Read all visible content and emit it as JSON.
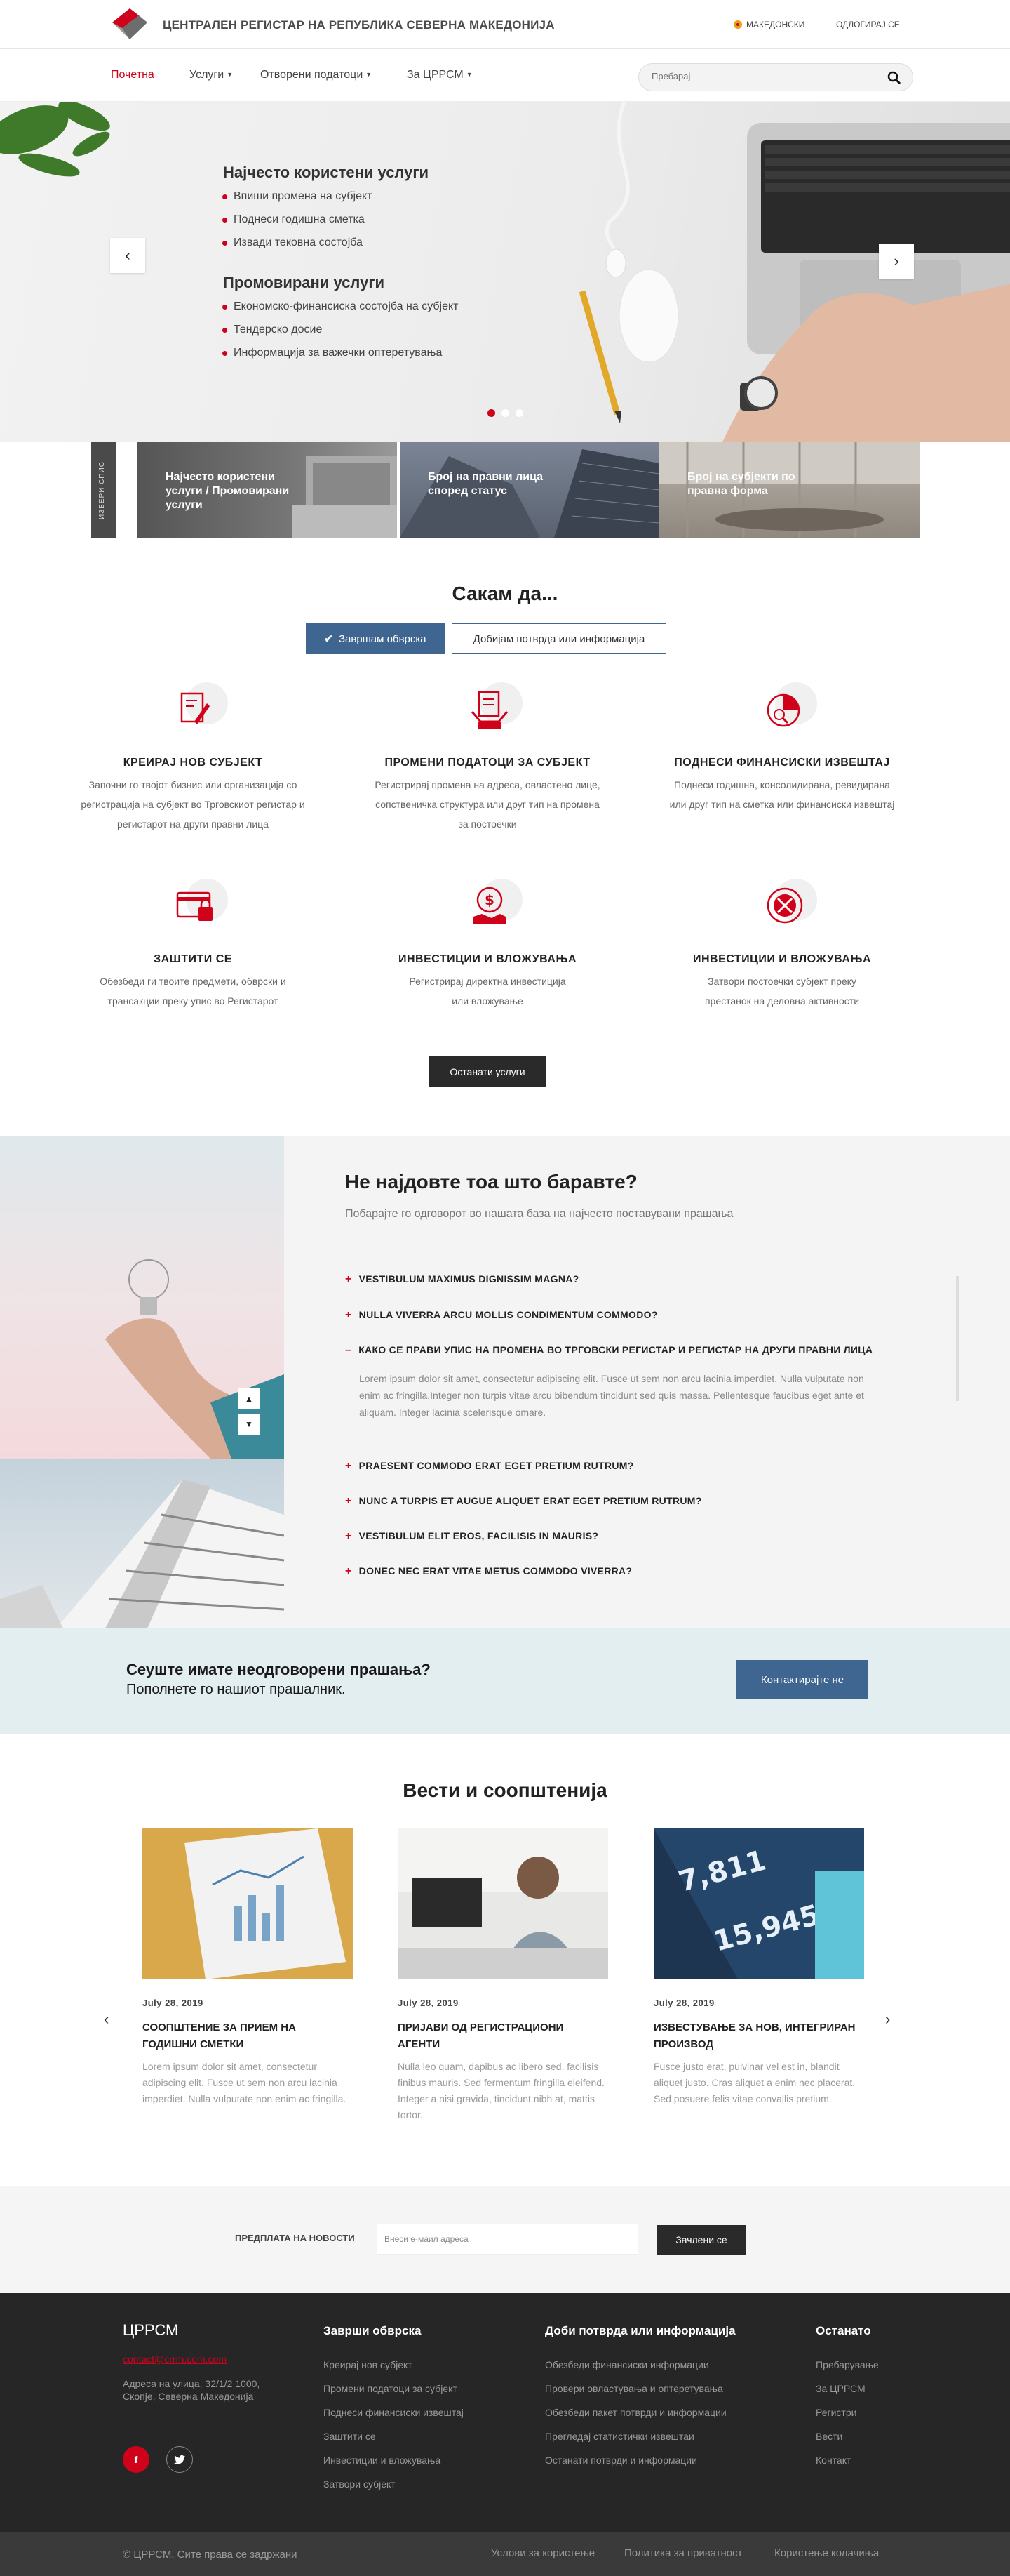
{
  "header": {
    "title": "ЦЕНТРАЛЕН РЕГИСТАР НА РЕПУБЛИКА СЕВЕРНА МАКЕДОНИЈА",
    "language": "МАКЕДОНСКИ",
    "logout": "ОДЛОГИРАЈ СЕ"
  },
  "nav": {
    "items": [
      "Почетна",
      "Услуги",
      "Отворени податоци",
      "За ЦРРСМ"
    ],
    "search_placeholder": "Пребарај"
  },
  "hero": {
    "heading1": "Најчесто користени услуги",
    "list1": [
      "Впиши промена на субјект",
      "Поднеси годишна сметка",
      "Извади тековна состојба"
    ],
    "heading2": "Промовирани услуги",
    "list2": [
      "Економско-финансиска состојба на субјект",
      "Тендерско досие",
      "Информација за важечки оптеретувања"
    ]
  },
  "tiles": {
    "side_label": "ИЗБЕРИ СПИС",
    "items": [
      "Најчесто користени услуги / Промовирани услуги",
      "Број на правни лица според статус",
      "Број на субјекти по правна форма"
    ]
  },
  "want": {
    "title": "Сакам да...",
    "tab_active": "Завршам обврска",
    "tab_other": "Добијам потврда или информација"
  },
  "services": [
    {
      "title": "КРЕИРАЈ НОВ СУБЈЕКТ",
      "desc": "Започни го твојот бизнис или организација со регистрација на субјект во Трговскиот регистар и регистарот на други правни лица"
    },
    {
      "title": "ПРОМЕНИ ПОДАТОЦИ ЗА СУБЈЕКТ",
      "desc": "Регистрирај промена на адреса, овластено лице, сопственичка структура или друг тип на промена за постоечки"
    },
    {
      "title": "ПОДНЕСИ ФИНАНСИСКИ ИЗВЕШТАЈ",
      "desc": "Поднеси годишна, консолидирана, ревидирана или друг тип на сметка или финансиски извештај"
    },
    {
      "title": "ЗАШТИТИ СЕ",
      "desc": "Обезбеди ги твоите предмети, обврски и трансакции преку упис во Регистарот"
    },
    {
      "title": "ИНВЕСТИЦИИ И ВЛОЖУВАЊА",
      "desc": "Регистрирај директна инвестиција или вложување"
    },
    {
      "title": "ИНВЕСТИЦИИ И ВЛОЖУВАЊА",
      "desc": "Затвори постоечки субјект преку престанок на деловна активности"
    }
  ],
  "other_services": "Останати услуги",
  "faq": {
    "title": "Не најдовте тоа што баравте?",
    "subtitle": "Побарајте го одговорот во нашата база на најчесто поставувани прашања",
    "items": [
      "VESTIBULUM MAXIMUS DIGNISSIM MAGNA?",
      "NULLA VIVERRA ARCU MOLLIS CONDIMENTUM COMMODO?",
      "КАКО СЕ ПРАВИ УПИС НА ПРОМЕНА ВО ТРГОВСКИ РЕГИСТАР И РЕГИСТАР НА ДРУГИ ПРАВНИ ЛИЦА",
      "PRAESENT COMMODO ERAT EGET PRETIUM RUTRUM?",
      "NUNC A TURPIS ET AUGUE ALIQUET ERAT EGET PRETIUM RUTRUM?",
      "VESTIBULUM ELIT EROS, FACILISIS IN MAURIS?",
      "DONEC NEC ERAT VITAE METUS COMMODO VIVERRA?"
    ],
    "answer": "Lorem ipsum dolor sit amet, consectetur adipiscing elit. Fusce ut sem non arcu lacinia imperdiet. Nulla vulputate non enim ac fringilla.Integer non turpis vitae arcu bibendum tincidunt sed quis massa. Pellentesque faucibus eget ante et aliquam. Integer lacinia scelerisque omare."
  },
  "contact": {
    "heading": "Сеуште имате неодговорени прашања?",
    "sub": "Пополнете го нашиот прашалник.",
    "button": "Контактирајте не"
  },
  "news": {
    "title": "Вести и соопштенија",
    "items": [
      {
        "date": "July 28, 2019",
        "title": "СООПШТЕНИЕ ЗА ПРИЕМ НА ГОДИШНИ СМЕТКИ",
        "text": "Lorem ipsum dolor sit amet, consectetur adipiscing elit. Fusce ut sem non arcu lacinia imperdiet. Nulla vulputate non enim ac fringilla."
      },
      {
        "date": "July 28, 2019",
        "title": "ПРИЈАВИ ОД РЕГИСТРАЦИОНИ АГЕНТИ",
        "text": "Nulla leo quam, dapibus ac libero sed, facilisis finibus mauris. Sed fermentum fringilla eleifend. Integer a nisi gravida, tincidunt nibh at, mattis tortor."
      },
      {
        "date": "July 28, 2019",
        "title": "ИЗВЕСТУВАЊЕ ЗА НОВ, ИНТЕГРИРАН ПРОИЗВОД",
        "text": "Fusce justo erat, pulvinar vel est in, blandit aliquet justo. Cras aliquet a enim nec placerat. Sed posuere felis vitae convallis pretium."
      }
    ]
  },
  "newsletter": {
    "label": "ПРЕДПЛАТА НА НОВОСТИ",
    "placeholder": "Внеси е-маил адреса",
    "button": "Зачлени се"
  },
  "footer": {
    "brand": "ЦРРСМ",
    "email": "contact@crrm.com.com",
    "address": "Адреса на улица, 32/1/2 1000, Скопје, Северна Македонија",
    "col1_title": "Заврши обврска",
    "col1": [
      "Креирај нов субјект",
      "Промени податоци за субјект",
      "Поднеси финансиски извештај",
      "Заштити се",
      "Инвестиции и вложувања",
      "Затвори субјект"
    ],
    "col2_title": "Доби потврда или информација",
    "col2": [
      "Обезбеди финансиски информации",
      "Провери овластувања и оптеретувања",
      "Обезбеди пакет потврди и информации",
      "Прегледај статистички извештаи",
      "Останати потврди и информации"
    ],
    "col3_title": "Останато",
    "col3": [
      "Пребарување",
      "За ЦРРСМ",
      "Регистри",
      "Вести",
      "Контакт"
    ],
    "copyright": "© ЦРРСМ. Сите права се задржани",
    "links": [
      "Услови за користење",
      "Политика за приватност",
      "Користење колачиња"
    ],
    "colors": {
      "accent": "#d0021b",
      "button_blue": "#3f6690",
      "dark": "#262626"
    }
  }
}
